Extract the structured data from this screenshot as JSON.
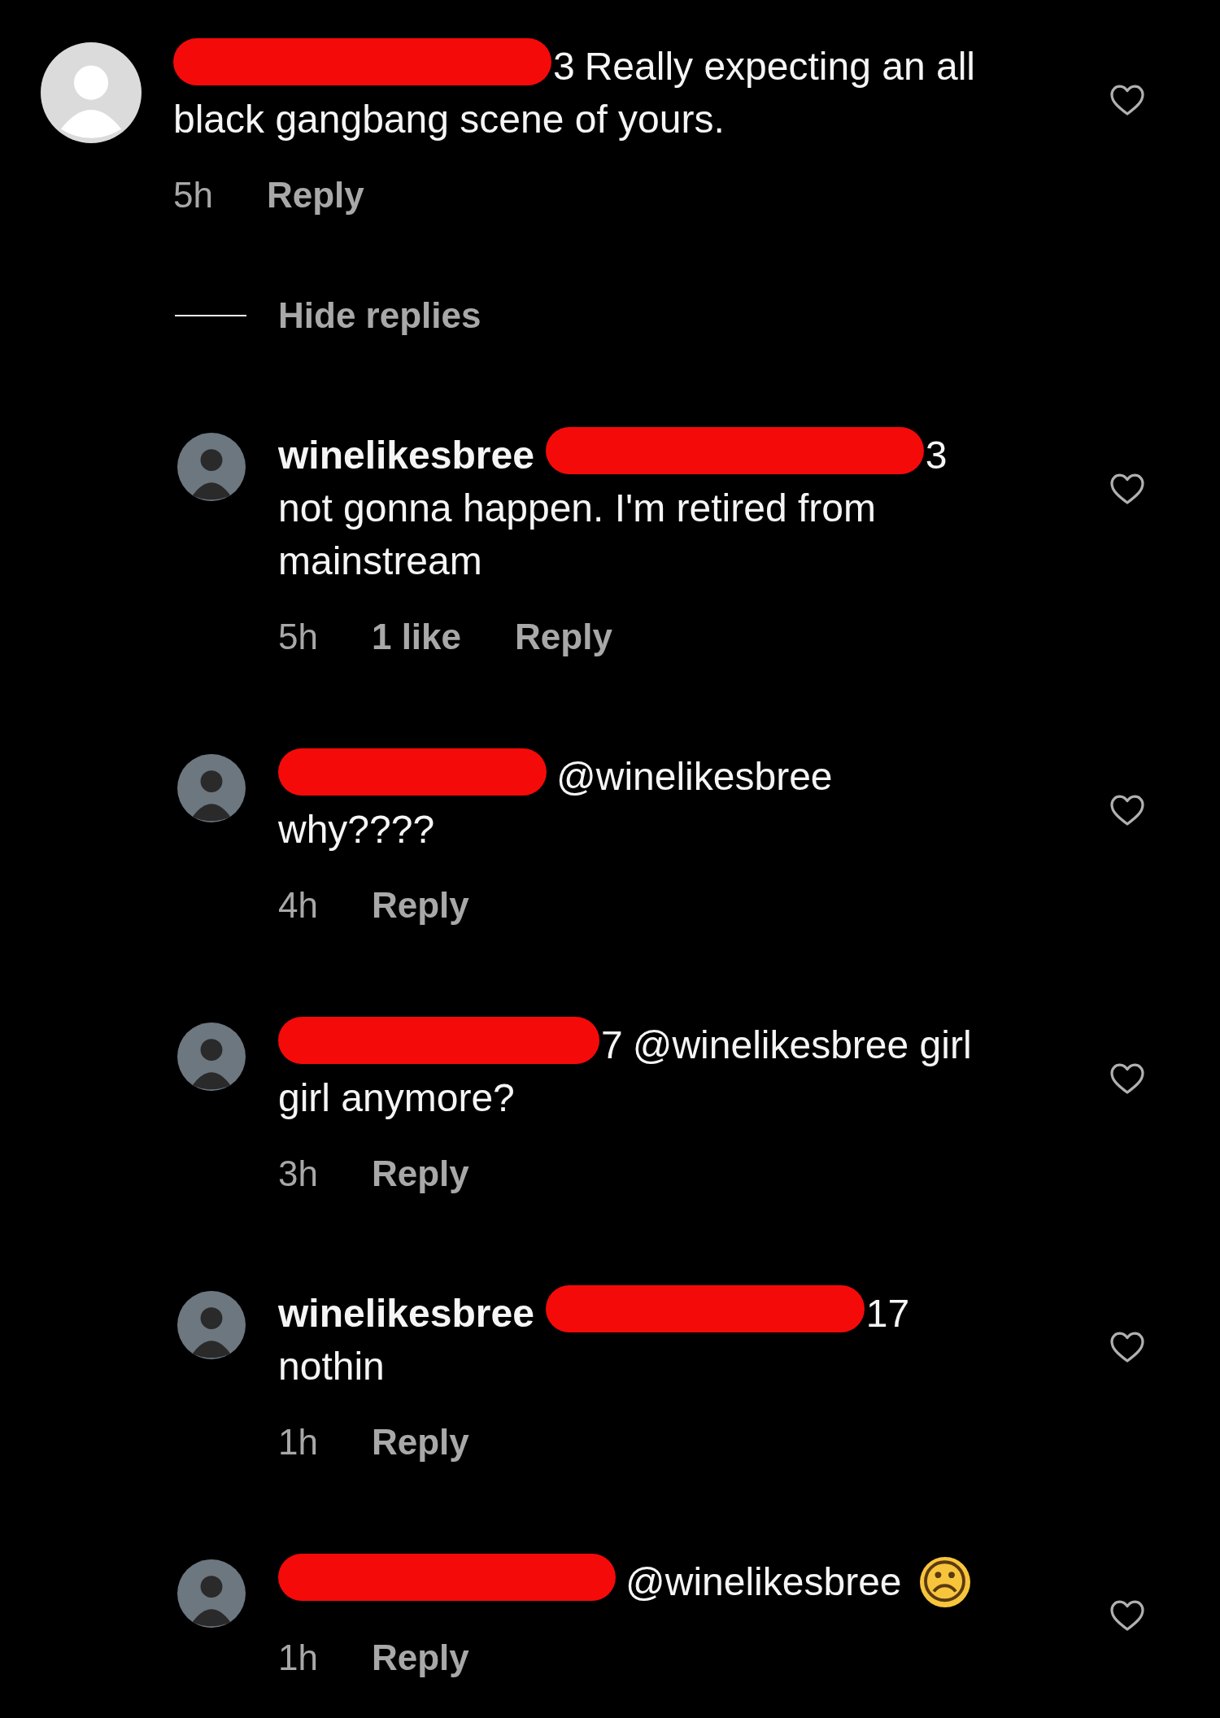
{
  "comment": {
    "redacted": true,
    "handle_tail": "3",
    "first_line": "Really expecting an all",
    "lines": [
      "black gangbang scene of yours."
    ],
    "time": "5h",
    "reply_label": "Reply",
    "liked": false
  },
  "hide_replies": "Hide replies",
  "replies": [
    {
      "author": "winelikesbree",
      "redacted": true,
      "handle_tail": "3",
      "lines": [
        "not gonna happen. I'm retired from",
        "mainstream"
      ],
      "time": "5h",
      "likes": "1 like",
      "reply_label": "Reply",
      "liked": false
    },
    {
      "redacted": true,
      "first_line": "@winelikesbree",
      "lines": [
        "why????"
      ],
      "time": "4h",
      "reply_label": "Reply",
      "liked": false
    },
    {
      "redacted": true,
      "handle_tail": "7",
      "first_line": "@winelikesbree girl",
      "lines": [
        "girl anymore?"
      ],
      "time": "3h",
      "reply_label": "Reply",
      "liked": false
    },
    {
      "author": "winelikesbree",
      "redacted": true,
      "handle_tail": "17",
      "lines": [
        "nothin"
      ],
      "time": "1h",
      "reply_label": "Reply",
      "liked": false
    },
    {
      "redacted": true,
      "first_line": "@winelikesbree",
      "emoji": "☹",
      "time": "1h",
      "reply_label": "Reply",
      "liked": false
    }
  ]
}
